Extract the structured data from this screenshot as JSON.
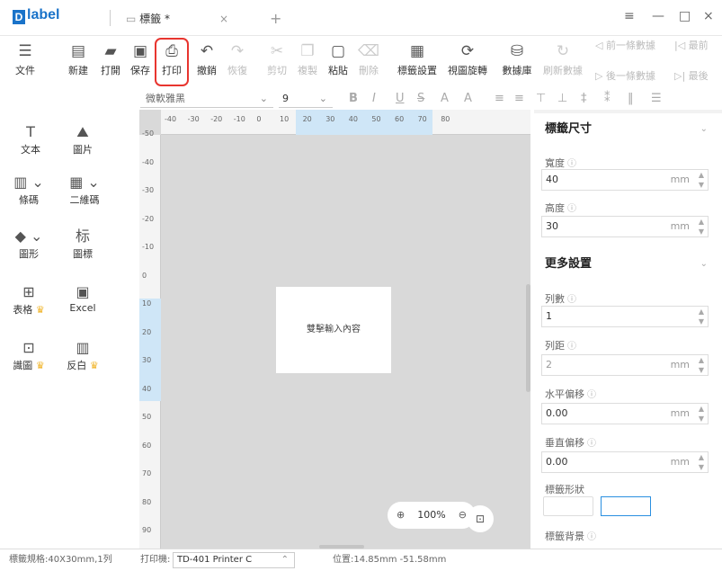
{
  "app": {
    "logo": "label",
    "tab_title": "標籤 *",
    "tab_close": "×",
    "new_tab": "+"
  },
  "window": {
    "menu": "≡",
    "minimize": "—",
    "maximize": "□",
    "close": "×"
  },
  "ribbon": {
    "file": "文件",
    "new": "新建",
    "open": "打開",
    "save": "保存",
    "print": "打印",
    "undo": "撤銷",
    "redo": "恢復",
    "cut": "剪切",
    "copy": "複製",
    "paste": "粘貼",
    "delete": "刪除",
    "label_settings": "標籤設置",
    "view_rotate": "視圖旋轉",
    "database": "數據庫",
    "refresh_data": "刷新數據",
    "prev_data": "前一條數據",
    "next_data": "後一條數據",
    "first": "最前",
    "last": "最後"
  },
  "format": {
    "font": "微軟雅黑",
    "size": "9",
    "bold": "B",
    "italic": "I",
    "underline": "U",
    "strike": "S",
    "font_a1": "A",
    "font_a2": "A"
  },
  "tools": {
    "text": "文本",
    "image": "圖片",
    "barcode": "條碼",
    "qrcode": "二維碼",
    "shape": "圖形",
    "icon": "圖標",
    "table": "表格",
    "excel": "Excel",
    "scan_image": "識圖",
    "invert": "反白",
    "icon_glyph": "标"
  },
  "canvas": {
    "placeholder": "雙擊輸入內容",
    "zoom": "100%",
    "hticks": [
      "-40",
      "-30",
      "-20",
      "-10",
      "0",
      "10",
      "20",
      "30",
      "40",
      "50",
      "60",
      "70",
      "80"
    ],
    "vticks": [
      "-50",
      "-40",
      "-30",
      "-20",
      "-10",
      "0",
      "10",
      "20",
      "30",
      "40",
      "50",
      "60",
      "70",
      "80",
      "90"
    ]
  },
  "props": {
    "size_title": "標籤尺寸",
    "width_label": "寬度",
    "width_value": "40",
    "height_label": "高度",
    "height_value": "30",
    "unit": "mm",
    "more_title": "更多設置",
    "cols_label": "列數",
    "cols_value": "1",
    "gap_label": "列距",
    "gap_value": "2",
    "hoffset_label": "水平偏移",
    "hoffset_value": "0.00",
    "voffset_label": "垂直偏移",
    "voffset_value": "0.00",
    "shape_label": "標籤形狀",
    "bg_label": "標籤背景"
  },
  "status": {
    "spec": "標籤規格:40X30mm,1列",
    "printer_label": "打印機:",
    "printer": "TD-401 Printer C",
    "position": "位置:14.85mm -51.58mm"
  }
}
